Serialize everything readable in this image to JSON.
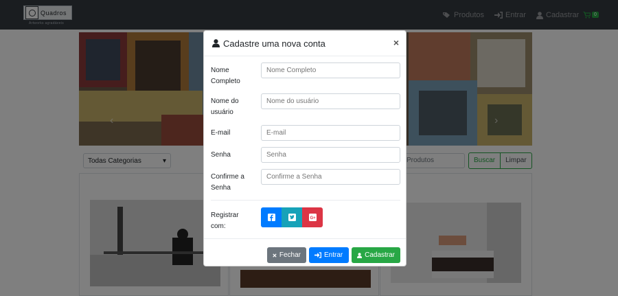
{
  "navbar": {
    "brand_name": "Quadros",
    "brand_tagline": "Artworks agradáveis",
    "items": [
      {
        "label": "Produtos",
        "icon": "tags-icon"
      },
      {
        "label": "Entrar",
        "icon": "sign-in-icon"
      },
      {
        "label": "Cadastrar",
        "icon": "user-icon"
      }
    ],
    "cart_count": "0"
  },
  "filters": {
    "category_selected": "Todas Categorias",
    "search_placeholder": "Produtos",
    "search_button": "Buscar",
    "clear_button": "Limpar"
  },
  "modal": {
    "title": "Cadastre uma nova conta",
    "fields": [
      {
        "label": "Nome Completo",
        "placeholder": "Nome Completo"
      },
      {
        "label": "Nome do usuário",
        "placeholder": "Nome do usuário"
      },
      {
        "label": "E-mail",
        "placeholder": "E-mail"
      },
      {
        "label": "Senha",
        "placeholder": "Senha"
      },
      {
        "label": "Confirme a Senha",
        "placeholder": "Confirme a Senha"
      }
    ],
    "social_label": "Registrar com:",
    "buttons": {
      "close": "Fechar",
      "login": "Entrar",
      "register": "Cadastrar"
    }
  },
  "colors": {
    "navbar": "#343a40",
    "primary": "#007bff",
    "success": "#28a745",
    "info": "#17a2b8",
    "danger": "#dc3545",
    "secondary": "#6c757d"
  }
}
